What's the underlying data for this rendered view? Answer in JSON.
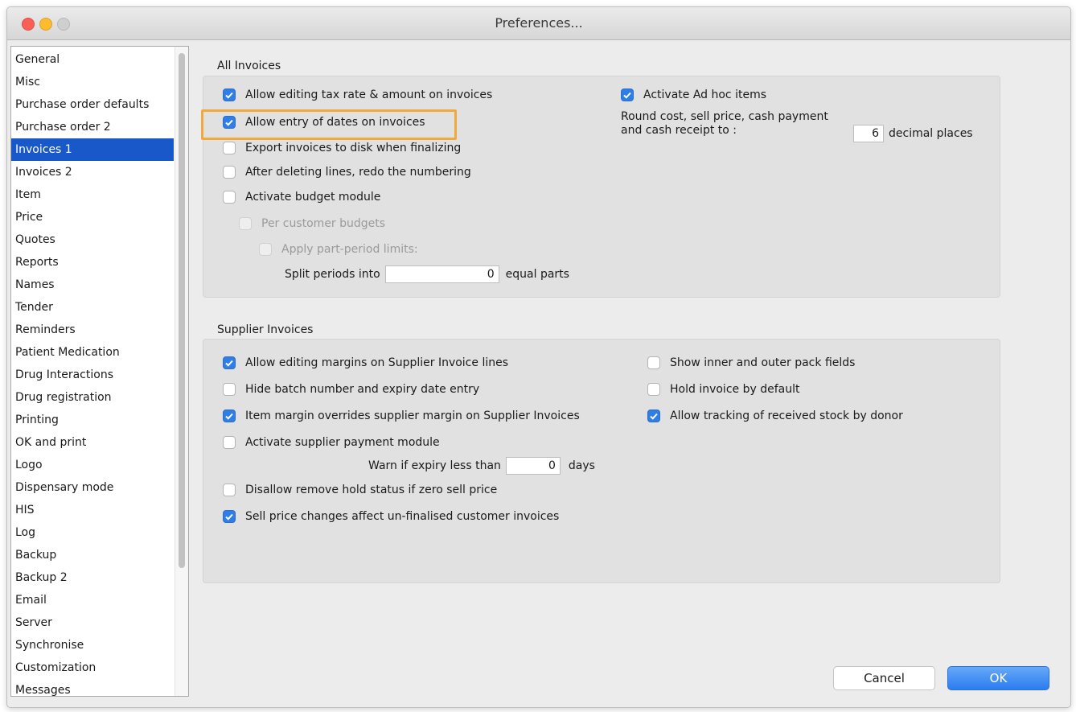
{
  "window": {
    "title": "Preferences..."
  },
  "sidebar": {
    "selected_index": 4,
    "items": [
      {
        "label": "General"
      },
      {
        "label": "Misc"
      },
      {
        "label": "Purchase order defaults"
      },
      {
        "label": "Purchase order 2"
      },
      {
        "label": "Invoices 1"
      },
      {
        "label": "Invoices 2"
      },
      {
        "label": "Item"
      },
      {
        "label": "Price"
      },
      {
        "label": "Quotes"
      },
      {
        "label": "Reports"
      },
      {
        "label": "Names"
      },
      {
        "label": "Tender"
      },
      {
        "label": "Reminders"
      },
      {
        "label": "Patient Medication"
      },
      {
        "label": "Drug Interactions"
      },
      {
        "label": "Drug registration"
      },
      {
        "label": "Printing"
      },
      {
        "label": "OK and print"
      },
      {
        "label": "Logo"
      },
      {
        "label": "Dispensary mode"
      },
      {
        "label": "HIS"
      },
      {
        "label": "Log"
      },
      {
        "label": "Backup"
      },
      {
        "label": "Backup 2"
      },
      {
        "label": "Email"
      },
      {
        "label": "Server"
      },
      {
        "label": "Synchronise"
      },
      {
        "label": "Customization"
      },
      {
        "label": "Messages"
      }
    ]
  },
  "all_invoices": {
    "title": "All Invoices",
    "options": [
      {
        "label": "Allow editing tax rate & amount on invoices",
        "checked": true,
        "enabled": true
      },
      {
        "label": "Allow entry of dates on invoices",
        "checked": true,
        "enabled": true
      },
      {
        "label": "Export invoices to disk when finalizing",
        "checked": false,
        "enabled": true
      },
      {
        "label": "After deleting lines, redo the numbering",
        "checked": false,
        "enabled": true
      },
      {
        "label": "Activate budget module",
        "checked": false,
        "enabled": true
      },
      {
        "label": "Per customer budgets",
        "checked": false,
        "enabled": false
      },
      {
        "label": "Apply part-period limits:",
        "checked": false,
        "enabled": false
      }
    ],
    "split_periods": {
      "label": "Split periods into",
      "value": "0",
      "suffix": "equal parts"
    },
    "adhoc": {
      "label": "Activate Ad hoc items",
      "checked": true
    },
    "rounding": {
      "line1": "Round cost, sell price, cash payment",
      "line2": "and cash receipt to :",
      "value": "6",
      "suffix": "decimal places"
    }
  },
  "supplier_invoices": {
    "title": "Supplier Invoices",
    "left_options": [
      {
        "label": "Allow editing margins on Supplier Invoice lines",
        "checked": true
      },
      {
        "label": "Hide batch number and expiry date entry",
        "checked": false
      },
      {
        "label": "Item margin overrides supplier margin on Supplier Invoices",
        "checked": true
      },
      {
        "label": "Activate supplier payment module",
        "checked": false
      }
    ],
    "warn_expiry": {
      "label": "Warn if expiry less than",
      "value": "0",
      "suffix": "days"
    },
    "lower_options": [
      {
        "label": "Disallow remove hold status if zero sell price",
        "checked": false
      },
      {
        "label": "Sell price changes affect un-finalised customer invoices",
        "checked": true
      }
    ],
    "right_options": [
      {
        "label": "Show inner and outer pack fields",
        "checked": false
      },
      {
        "label": "Hold invoice by default",
        "checked": false
      },
      {
        "label": "Allow tracking of received stock by donor",
        "checked": true
      }
    ]
  },
  "buttons": {
    "cancel": "Cancel",
    "ok": "OK"
  },
  "colors": {
    "accent": "#2f7ee8",
    "selection": "#1858c8",
    "highlight": "#f2a93b"
  },
  "icons": {
    "checkmark": "checkmark-icon"
  }
}
